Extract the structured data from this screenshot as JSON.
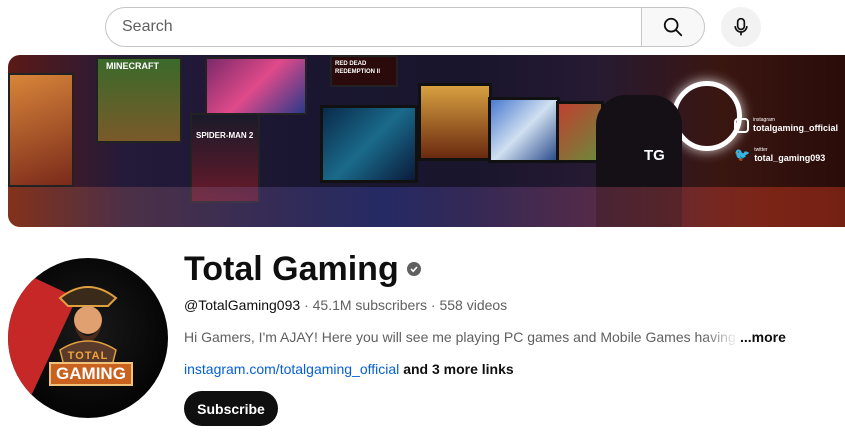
{
  "search": {
    "placeholder": "Search"
  },
  "icons": {
    "search": "search-icon",
    "mic": "microphone-icon",
    "verified": "verified-check-icon"
  },
  "banner": {
    "posters": [
      "MINECRAFT",
      "RED DEAD REDEMPTION II",
      "SPIDER-MAN 2"
    ],
    "tg_logo": "TG",
    "instagram": {
      "label": "instagram",
      "handle": "totalgaming_official"
    },
    "twitter": {
      "label": "twitter",
      "handle": "total_gaming093"
    }
  },
  "avatar": {
    "text_top": "TOTAL",
    "text_bottom": "GAMING"
  },
  "channel": {
    "name": "Total Gaming",
    "handle": "@TotalGaming093",
    "sep1": "·",
    "subscribers": "45.1M subscribers",
    "sep2": "·",
    "videos": "558 videos",
    "description": "Hi Gamers,  I'm AJAY! Here you will see me playing PC games and Mobile Games having fun",
    "more_label": "...more",
    "link": "instagram.com/totalgaming_official",
    "more_links": "and 3 more links",
    "subscribe_label": "Subscribe"
  },
  "colors": {
    "link": "#065fd4",
    "subscribe_bg": "#0f0f0f",
    "text_secondary": "#606060"
  }
}
